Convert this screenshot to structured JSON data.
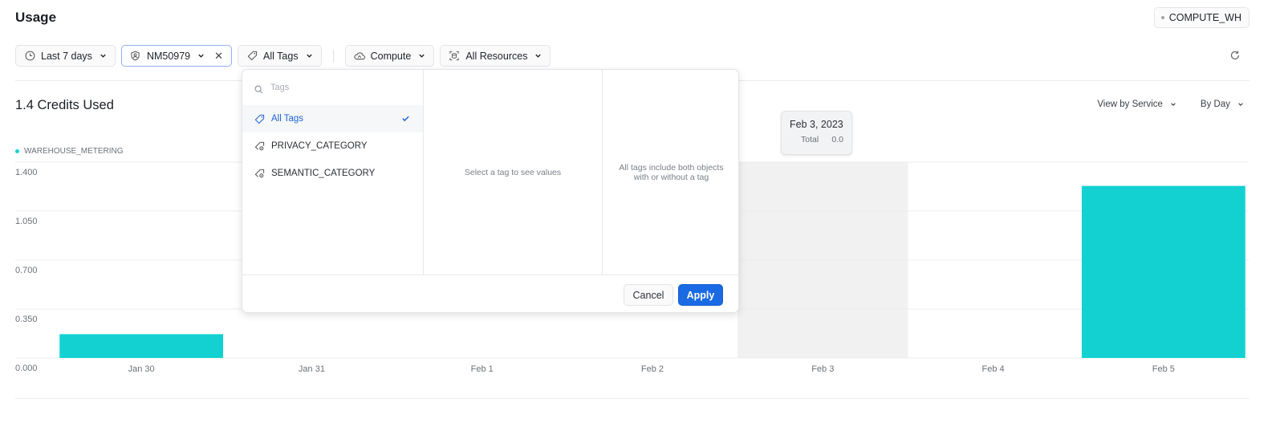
{
  "page": {
    "title": "Usage"
  },
  "warehouse_chip": {
    "label": "COMPUTE_WH"
  },
  "filters": {
    "date_range": {
      "label": "Last 7 days",
      "icon": "clock-icon"
    },
    "account": {
      "label": "NM50979",
      "icon": "user-shield-icon",
      "clearable": true
    },
    "tags": {
      "label": "All Tags",
      "icon": "tag-icon"
    },
    "service_type": {
      "label": "Compute",
      "icon": "cloud-compute-icon"
    },
    "resources": {
      "label": "All Resources",
      "icon": "resources-icon"
    }
  },
  "summary": {
    "title": "1.4 Credits Used"
  },
  "view_controls": {
    "view_by": "View by Service",
    "granularity": "By Day"
  },
  "tag_popup": {
    "search_placeholder": "Tags",
    "items": [
      {
        "label": "All Tags",
        "selected": true,
        "icon": "tag-icon"
      },
      {
        "label": "PRIVACY_CATEGORY",
        "selected": false,
        "icon": "tag-settings-icon"
      },
      {
        "label": "SEMANTIC_CATEGORY",
        "selected": false,
        "icon": "tag-settings-icon"
      }
    ],
    "values_empty_text": "Select a tag to see values",
    "info_text": "All tags include both objects with or without a tag",
    "cancel_label": "Cancel",
    "apply_label": "Apply"
  },
  "tooltip": {
    "date": "Feb 3, 2023",
    "label": "Total",
    "value": "0.0"
  },
  "colors": {
    "series": "#13d1d1",
    "accent": "#1a6ae3",
    "hover_column": "#f1f1f1"
  },
  "chart_data": {
    "type": "bar",
    "title": "1.4 Credits Used",
    "xlabel": "",
    "ylabel": "",
    "categories": [
      "Jan 30",
      "Jan 31",
      "Feb 1",
      "Feb 2",
      "Feb 3",
      "Feb 4",
      "Feb 5"
    ],
    "series": [
      {
        "name": "WAREHOUSE_METERING",
        "values": [
          0.17,
          0,
          0,
          0,
          0,
          0,
          1.23
        ]
      }
    ],
    "ylim": [
      0,
      1.4
    ],
    "yticks": [
      0,
      0.35,
      0.7,
      1.05,
      1.4
    ],
    "ytick_labels": [
      "0.000",
      "0.350",
      "0.700",
      "1.050",
      "1.400"
    ],
    "grid": true,
    "legend": "top-left",
    "hovered_category": "Feb 3"
  }
}
